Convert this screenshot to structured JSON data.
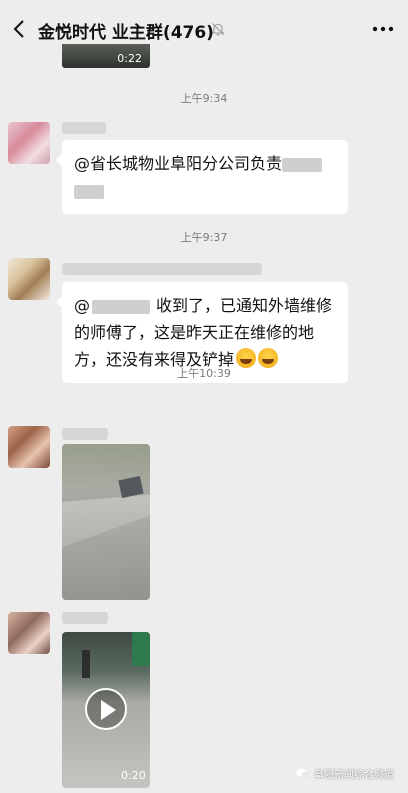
{
  "header": {
    "title": "金悦时代 业主群(476)",
    "back_icon": "chevron-left-icon",
    "mute_icon": "bell-muted-icon",
    "more_icon": "more-dots-icon"
  },
  "messages": {
    "video_top_duration": "0:22",
    "time1": "上午9:34",
    "msg1_text": "@省长城物业阜阳分公司负责",
    "time2": "上午9:37",
    "msg2_prefix": "@",
    "msg2_text": "收到了，已通知外墙维修的师傅了，这是昨天正在维修的地方，还没有来得及铲掉",
    "time3": "上午10:39",
    "video_bottom_duration": "0:20"
  },
  "watermark": {
    "text": "阜阳新闻综合频道"
  },
  "colors": {
    "background": "#ededed",
    "bubble": "#ffffff",
    "timestamp": "#7a7a7a"
  }
}
